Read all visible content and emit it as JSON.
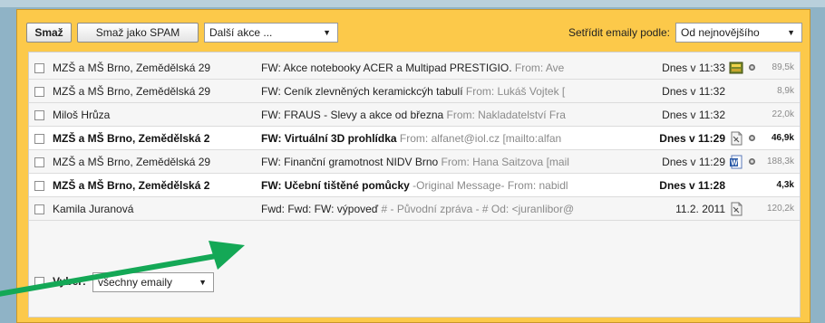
{
  "toolbar": {
    "delete_label": "Smaž",
    "spam_label": "Smaž jako SPAM",
    "actions_value": "Další akce ...",
    "sort_label": "Setřídit emaily podle:",
    "sort_value": "Od nejnovějšího"
  },
  "emails": [
    {
      "sender": "MZŠ a MŠ Brno, Zemědělská 29",
      "subject": "FW: Akce notebooky ACER a Multipad PRESTIGIO.",
      "preview": " From: Ave",
      "date": "Dnes v 11:33",
      "size": "89,5k",
      "unread": false,
      "attachment": "zip-attachment-icon",
      "has_dot": true
    },
    {
      "sender": "MZŠ a MŠ Brno, Zemědělská 29",
      "subject": "FW: Ceník zlevněných keramickcýh tabulí",
      "preview": " From: Lukáš Vojtek [",
      "date": "Dnes v 11:32",
      "size": "8,9k",
      "unread": false,
      "attachment": "",
      "has_dot": false
    },
    {
      "sender": "Miloš Hrůza",
      "subject": "FW: FRAUS - Slevy a akce od března",
      "preview": " From: Nakladatelství Fra",
      "date": "Dnes v 11:32",
      "size": "22,0k",
      "unread": false,
      "attachment": "",
      "has_dot": false
    },
    {
      "sender": "MZŠ a MŠ Brno, Zemědělská 2",
      "subject": "FW: Virtuální 3D prohlídka",
      "preview": " From: alfanet@iol.cz [mailto:alfan",
      "date": "Dnes v 11:29",
      "size": "46,9k",
      "unread": true,
      "attachment": "file-attachment-icon",
      "has_dot": true
    },
    {
      "sender": "MZŠ a MŠ Brno, Zemědělská 29",
      "subject": "FW: Finanční gramotnost NIDV Brno",
      "preview": " From: Hana Saitzova [mail",
      "date": "Dnes v 11:29",
      "size": "188,3k",
      "unread": false,
      "attachment": "word-attachment-icon",
      "has_dot": true
    },
    {
      "sender": "MZŠ a MŠ Brno, Zemědělská 2",
      "subject": "FW: Učební tištěné pomůcky",
      "preview": " -Original Message- From: nabidl",
      "date": "Dnes v 11:28",
      "size": "4,3k",
      "unread": true,
      "attachment": "",
      "has_dot": false
    },
    {
      "sender": "Kamila Juranová",
      "subject": "Fwd: Fwd: FW: výpoveď",
      "preview": " # - Původní zpráva - # Od: <juranlibor@",
      "date": "11.2. 2011",
      "size": "120,2k",
      "unread": false,
      "attachment": "file-attachment-icon",
      "has_dot": false
    }
  ],
  "footer": {
    "select_label": "Vyber:",
    "select_value": "všechny emaily"
  },
  "colors": {
    "panel": "#fcc94a",
    "background": "#8fb3c6",
    "arrow": "#14a856",
    "unread_bg": "#ffffff",
    "read_bg": "#f6f6f6"
  }
}
